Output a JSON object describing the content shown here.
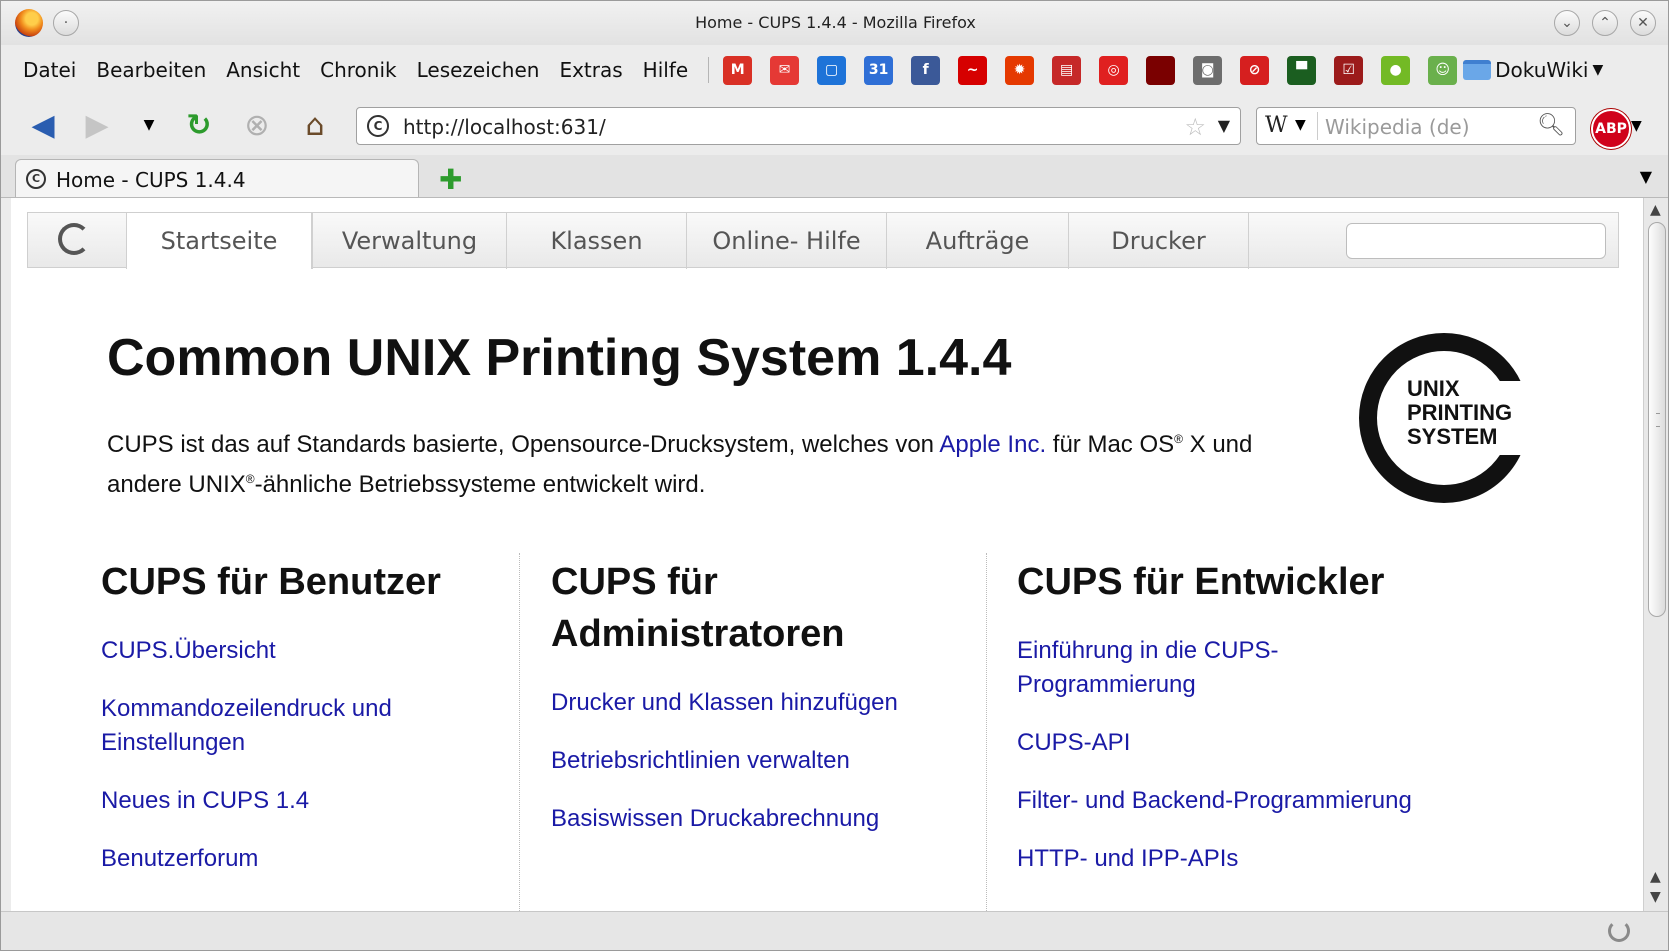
{
  "window": {
    "title": "Home - CUPS 1.4.4 - Mozilla Firefox"
  },
  "menubar": {
    "items": [
      "Datei",
      "Bearbeiten",
      "Ansicht",
      "Chronik",
      "Lesezeichen",
      "Extras",
      "Hilfe"
    ],
    "folder_label": "DokuWiki"
  },
  "bookmark_icons": [
    {
      "name": "gmail-icon",
      "color": "#d93025",
      "glyph": "M"
    },
    {
      "name": "mail-icon",
      "color": "#e53935",
      "glyph": "✉"
    },
    {
      "name": "docs-icon",
      "color": "#1e73d8",
      "glyph": "▢"
    },
    {
      "name": "calendar-icon",
      "color": "#2f6fd6",
      "glyph": "31"
    },
    {
      "name": "facebook-icon",
      "color": "#3b5998",
      "glyph": "f"
    },
    {
      "name": "wave-icon",
      "color": "#d60000",
      "glyph": "~"
    },
    {
      "name": "sun-icon",
      "color": "#e53900",
      "glyph": "✹"
    },
    {
      "name": "chart-icon",
      "color": "#c62828",
      "glyph": "▤"
    },
    {
      "name": "target-icon",
      "color": "#e02020",
      "glyph": "◎"
    },
    {
      "name": "square-icon",
      "color": "#7a0000",
      "glyph": ""
    },
    {
      "name": "window-icon",
      "color": "#6d6d6d",
      "glyph": "◙"
    },
    {
      "name": "nosign-icon",
      "color": "#d61f1f",
      "glyph": "⊘"
    },
    {
      "name": "flag-icon",
      "color": "#1b5e20",
      "glyph": "▀"
    },
    {
      "name": "check-icon",
      "color": "#9c1b1b",
      "glyph": "☑"
    },
    {
      "name": "opensuse-icon",
      "color": "#73ba25",
      "glyph": "●"
    },
    {
      "name": "smile-icon",
      "color": "#6ab04c",
      "glyph": "☺"
    }
  ],
  "navigation": {
    "url": "http://localhost:631/",
    "search_placeholder": "Wikipedia (de)",
    "search_engine_glyph": "W",
    "abp_label": "ABP"
  },
  "tabs": [
    {
      "label": "Home - CUPS 1.4.4"
    }
  ],
  "cups_nav": {
    "items": [
      "Startseite",
      "Verwaltung",
      "Klassen",
      "Online- Hilfe",
      "Aufträge",
      "Drucker"
    ],
    "active": "Startseite"
  },
  "page": {
    "title": "Common UNIX Printing System 1.4.4",
    "intro_part1": "CUPS ist das auf Standards basierte, Opensource-Drucksystem, welches von ",
    "intro_link": "Apple Inc.",
    "intro_part2": " für Mac OS",
    "intro_sup1": "®",
    "intro_part3": " X und andere UNIX",
    "intro_sup2": "®",
    "intro_part4": "-ähnliche Betriebssysteme entwickelt wird.",
    "logo_text": [
      "UNIX",
      "PRINTING",
      "SYSTEM"
    ]
  },
  "columns": [
    {
      "heading": "CUPS für Benutzer",
      "links": [
        "CUPS.Übersicht",
        "Kommandozeilendruck und Einstellungen",
        "Neues in CUPS 1.4",
        "Benutzerforum"
      ]
    },
    {
      "heading": "CUPS für Administratoren",
      "links": [
        "Drucker und Klassen hinzufügen",
        "Betriebsrichtlinien verwalten",
        "Basiswissen Druckabrechnung"
      ]
    },
    {
      "heading": "CUPS für Entwickler",
      "links": [
        "Einführung in die CUPS-Programmierung",
        "CUPS-API",
        "Filter- und Backend-Programmierung",
        "HTTP- und IPP-APIs"
      ]
    }
  ]
}
